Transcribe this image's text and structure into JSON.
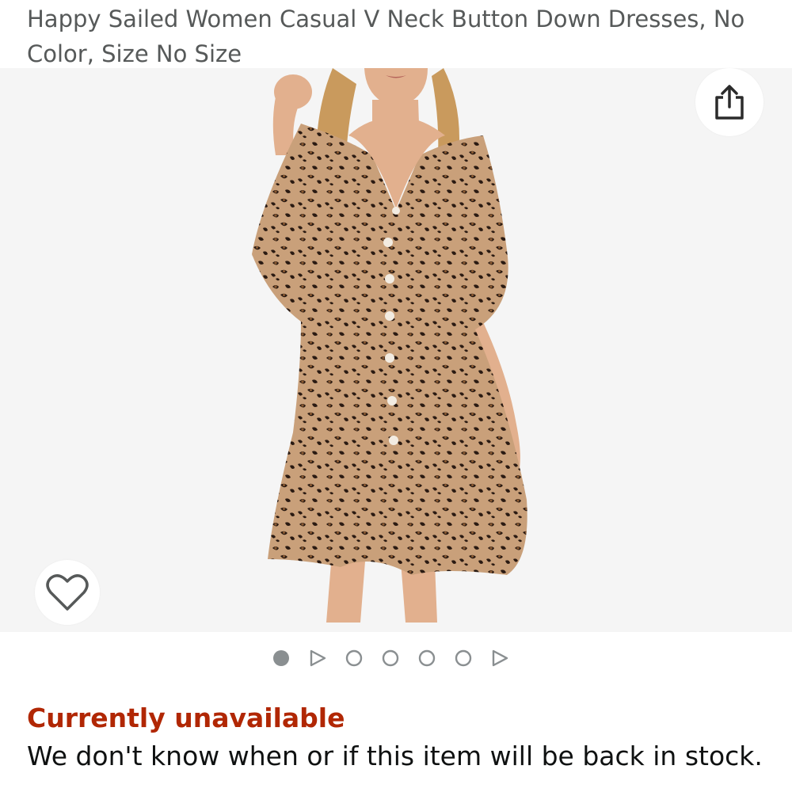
{
  "product": {
    "title": "Happy Sailed Women Casual V Neck Button Down Dresses, No Color, Size No Size",
    "image_alt": "Leopard print V neck button down dress"
  },
  "gallery": {
    "share_icon": "share-icon",
    "wishlist_icon": "heart-outline-icon",
    "indicators": [
      {
        "type": "image",
        "active": true
      },
      {
        "type": "video",
        "active": false
      },
      {
        "type": "image",
        "active": false
      },
      {
        "type": "image",
        "active": false
      },
      {
        "type": "image",
        "active": false
      },
      {
        "type": "image",
        "active": false
      },
      {
        "type": "video",
        "active": false
      }
    ]
  },
  "availability": {
    "status": "Currently unavailable",
    "message": "We don't know when or if this item will be back in stock."
  },
  "colors": {
    "status": "#b12704",
    "title": "#565959",
    "text": "#0f1111",
    "gallery_bg": "#f5f5f5",
    "leopard_base": "#c9a07a",
    "skin": "#e2b08e",
    "hair": "#c99a5d"
  }
}
